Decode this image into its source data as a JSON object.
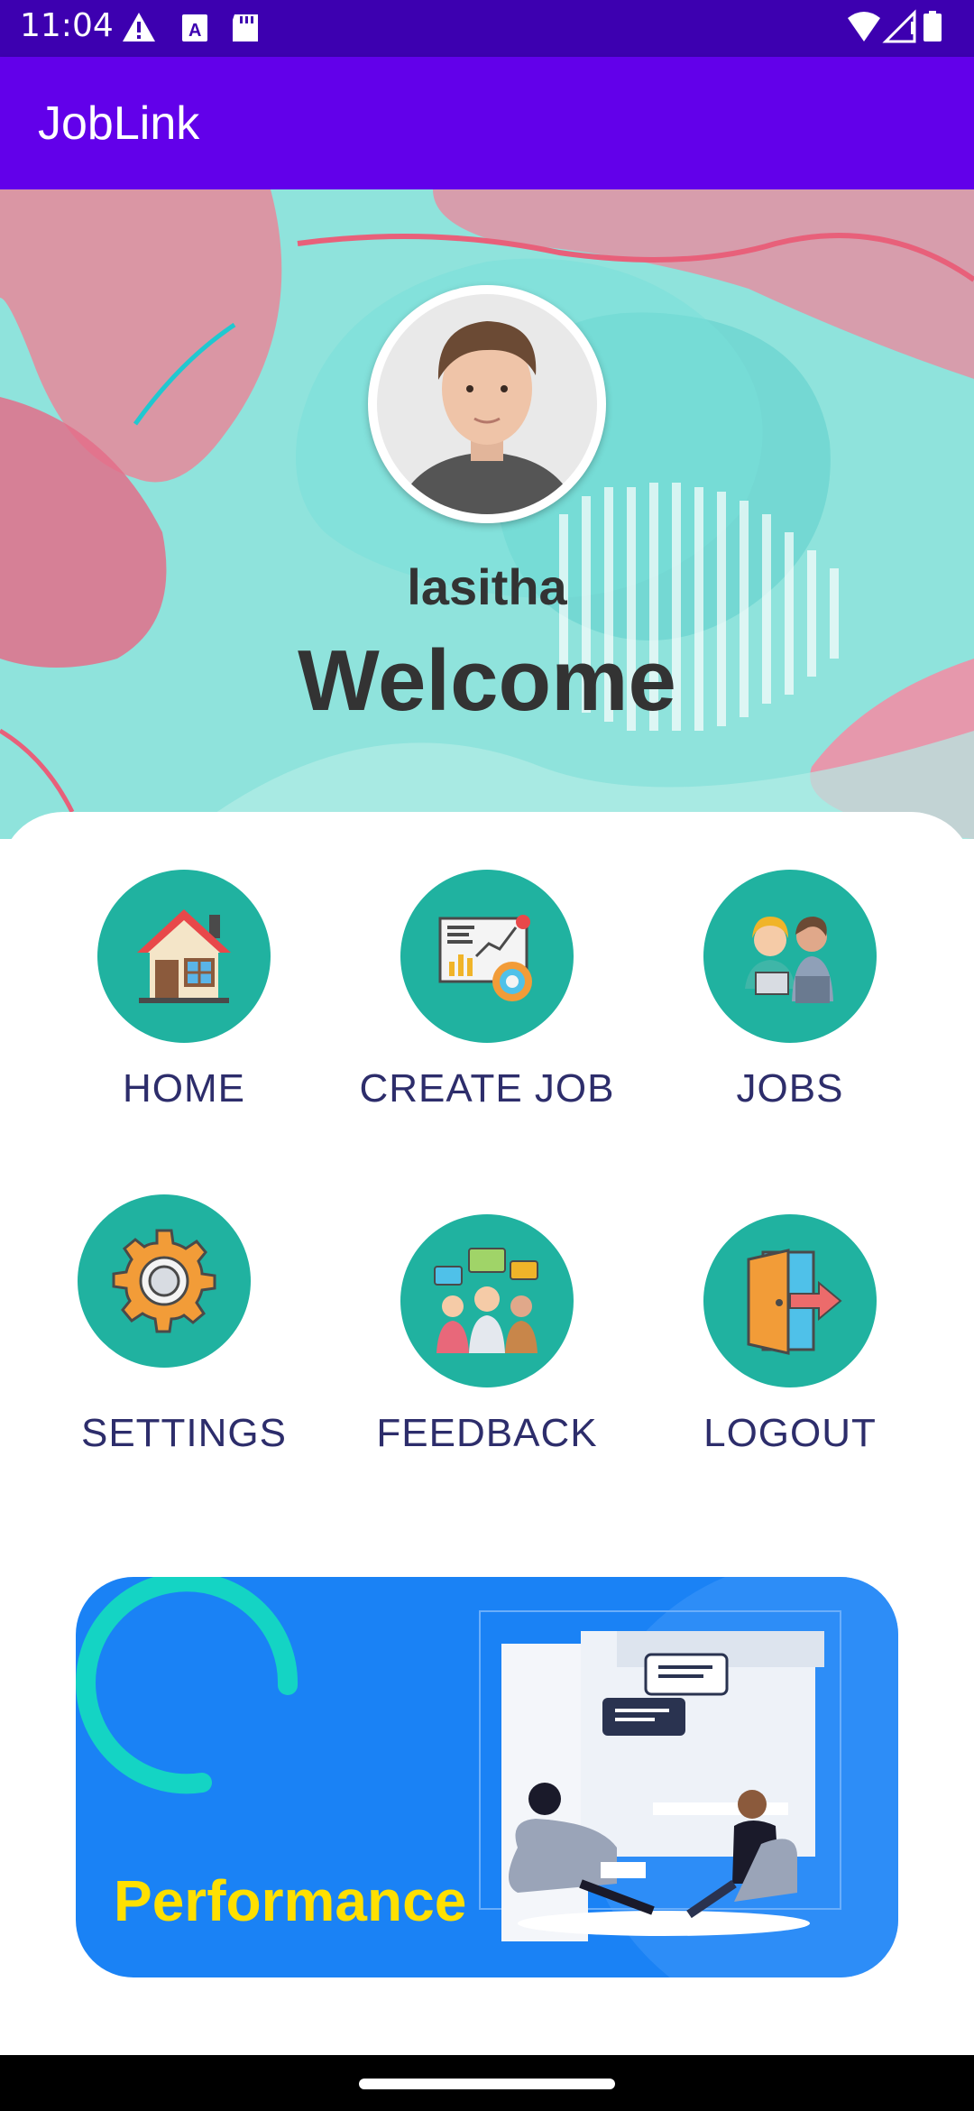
{
  "status_bar": {
    "time": "11:04",
    "icons": [
      "warning-icon",
      "font-icon",
      "sd-card-icon",
      "wifi-icon",
      "signal-icon",
      "battery-icon"
    ]
  },
  "app_bar": {
    "title": "JobLink"
  },
  "profile": {
    "username": "lasitha",
    "greeting": "Welcome"
  },
  "menu": {
    "home": "HOME",
    "create_job": "CREATE JOB",
    "jobs": "JOBS",
    "settings": "SETTINGS",
    "feedback": "FEEDBACK",
    "logout": "LOGOUT"
  },
  "performance": {
    "title": "Performance"
  },
  "colors": {
    "status_bar": "#3d00b0",
    "app_bar": "#6200ea",
    "tile_circle": "#20b2a0",
    "label_text": "#2d2d6b",
    "performance_card": "#1a82f5",
    "performance_title": "#ffe000"
  }
}
